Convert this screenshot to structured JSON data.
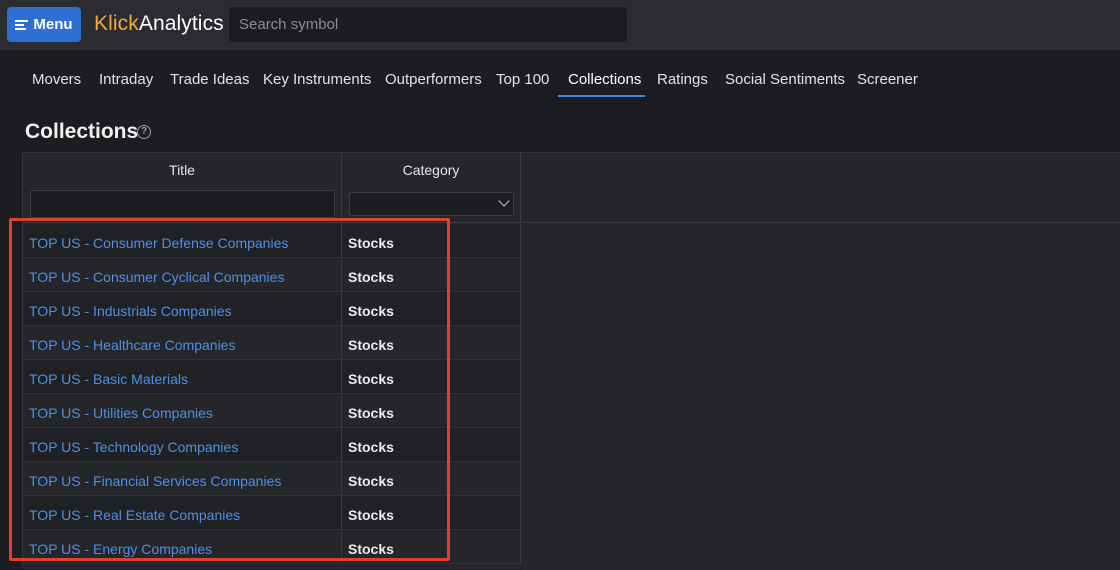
{
  "header": {
    "menu_label": "Menu",
    "logo_part1": "Klick",
    "logo_part2": "Analytics",
    "search_placeholder": "Search symbol"
  },
  "nav": {
    "tabs": [
      {
        "label": "Movers"
      },
      {
        "label": "Intraday"
      },
      {
        "label": "Trade Ideas"
      },
      {
        "label": "Key Instruments"
      },
      {
        "label": "Outperformers"
      },
      {
        "label": "Top 100"
      },
      {
        "label": "Collections",
        "active": true
      },
      {
        "label": "Ratings"
      },
      {
        "label": "Social Sentiments"
      },
      {
        "label": "Screener"
      }
    ]
  },
  "page": {
    "title": "Collections",
    "help_icon": "?"
  },
  "grid": {
    "columns": [
      "Title",
      "Category"
    ],
    "rows": [
      {
        "title": "TOP US - Consumer Defense Companies",
        "category": "Stocks"
      },
      {
        "title": "TOP US - Consumer Cyclical Companies",
        "category": "Stocks"
      },
      {
        "title": "TOP US - Industrials Companies",
        "category": "Stocks"
      },
      {
        "title": "TOP US - Healthcare Companies",
        "category": "Stocks"
      },
      {
        "title": "TOP US - Basic Materials",
        "category": "Stocks"
      },
      {
        "title": "TOP US - Utilities Companies",
        "category": "Stocks"
      },
      {
        "title": "TOP US - Technology Companies",
        "category": "Stocks"
      },
      {
        "title": "TOP US - Financial Services Companies",
        "category": "Stocks"
      },
      {
        "title": "TOP US - Real Estate Companies",
        "category": "Stocks"
      },
      {
        "title": "TOP US - Energy Companies",
        "category": "Stocks"
      }
    ]
  },
  "colors": {
    "accent": "#2f6fd1",
    "link": "#4f8fe6",
    "logo_orange": "#f2a83b",
    "highlight": "#e0402f"
  }
}
